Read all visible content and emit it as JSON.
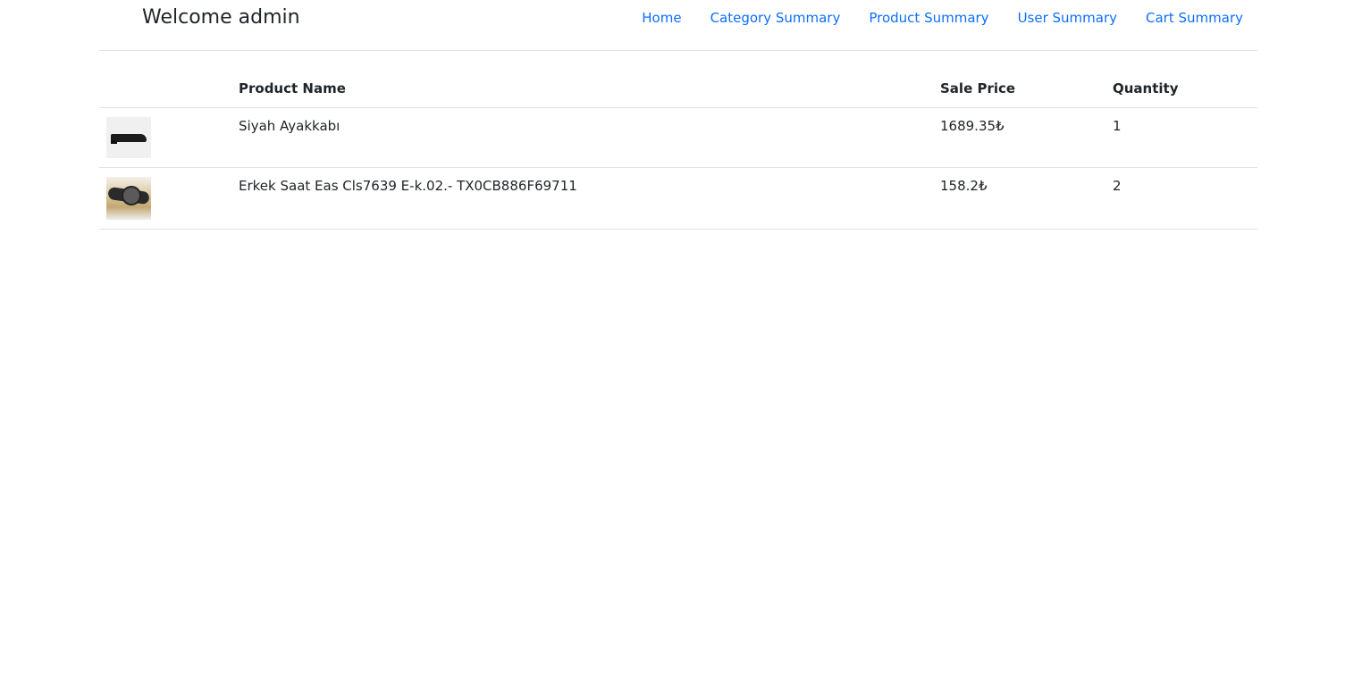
{
  "header": {
    "welcome": "Welcome admin",
    "nav": [
      "Home",
      "Category Summary",
      "Product Summary",
      "User Summary",
      "Cart Summary"
    ]
  },
  "table": {
    "columns": [
      "",
      "Product Name",
      "Sale Price",
      "Quantity"
    ],
    "rows": [
      {
        "image_icon": "shoe-image",
        "name": "Siyah Ayakkabı",
        "price": "1689.35₺",
        "quantity": "1"
      },
      {
        "image_icon": "watch-image",
        "name": "Erkek Saat Eas Cls7639 E-k.02.- TX0CB886F69711",
        "price": "158.2₺",
        "quantity": "2"
      }
    ]
  },
  "colors": {
    "link": "#0d6efd",
    "text": "#212529",
    "border": "#dee2e6"
  }
}
